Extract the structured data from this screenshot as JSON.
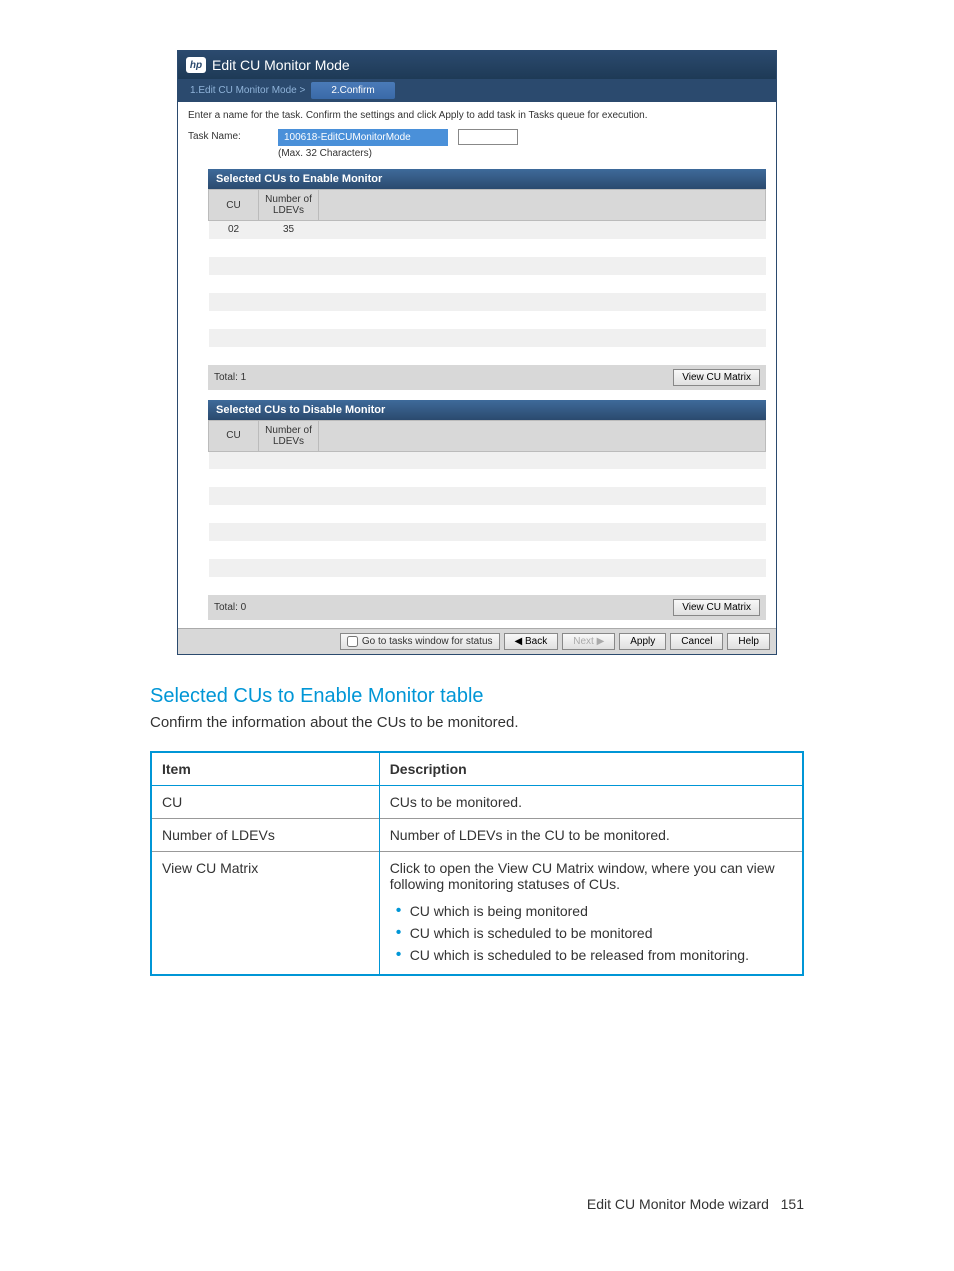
{
  "dialog": {
    "title": "Edit CU Monitor Mode",
    "steps": {
      "prev": "1.Edit CU Monitor Mode  >",
      "current": "2.Confirm"
    },
    "instruction": "Enter a name for the task. Confirm the settings and click Apply to add task in Tasks queue for execution.",
    "taskName": {
      "label": "Task Name:",
      "value": "100618-EditCUMonitorMode",
      "hint": "(Max. 32 Characters)"
    },
    "enableSection": {
      "header": "Selected CUs to Enable Monitor",
      "columns": {
        "cu": "CU",
        "num": "Number of LDEVs"
      },
      "rows": [
        {
          "cu": "02",
          "num": "35"
        }
      ],
      "total": "Total: 1",
      "viewBtn": "View CU Matrix"
    },
    "disableSection": {
      "header": "Selected CUs to Disable Monitor",
      "columns": {
        "cu": "CU",
        "num": "Number of LDEVs"
      },
      "rows": [],
      "total": "Total: 0",
      "viewBtn": "View CU Matrix"
    },
    "footer": {
      "checkbox": "Go to tasks window for status",
      "back": "Back",
      "next": "Next",
      "apply": "Apply",
      "cancel": "Cancel",
      "help": "Help"
    }
  },
  "doc": {
    "heading": "Selected CUs to Enable Monitor table",
    "text": "Confirm the information about the CUs to be monitored.",
    "table": {
      "headers": {
        "item": "Item",
        "desc": "Description"
      },
      "rows": [
        {
          "item": "CU",
          "desc": "CUs to be monitored."
        },
        {
          "item": "Number of LDEVs",
          "desc": "Number of LDEVs in the CU to be monitored."
        }
      ],
      "viewRow": {
        "item": "View CU Matrix",
        "desc": "Click to open the View CU Matrix window, where you can view following monitoring statuses of CUs.",
        "bullets": [
          "CU which is being monitored",
          "CU which is scheduled to be monitored",
          "CU which is scheduled to be released from monitoring."
        ]
      }
    },
    "footer": {
      "text": "Edit CU Monitor Mode wizard",
      "page": "151"
    }
  }
}
